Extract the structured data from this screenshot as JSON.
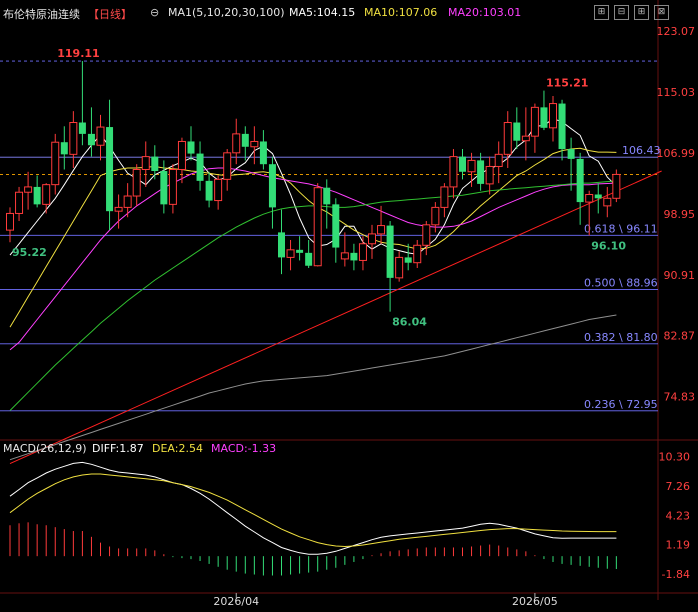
{
  "header": {
    "symbol": "布伦特原油连续",
    "period": "【日线】",
    "ma_label": "MA1(5,10,20,30,100)",
    "ma5": "MA5:104.15",
    "ma10": "MA10:107.06",
    "ma20": "MA20:103.01",
    "colors": {
      "symbol": "#e8e8e8",
      "period": "#ff4a4a",
      "ma5": "#ffffff",
      "ma10": "#f0e040",
      "ma20": "#ff40ff"
    }
  },
  "toolbar": {
    "icons": [
      "settings-icon",
      "grid-icon",
      "grid-icon",
      "close-icon"
    ],
    "glyphs": [
      "⊖",
      "⊞",
      "⊟",
      "⊠"
    ]
  },
  "main_axis": {
    "ylim": [
      69.5,
      124.0
    ],
    "ticks": [
      "123.07",
      "115.03",
      "106.99",
      "98.95",
      "90.91",
      "82.87",
      "74.83"
    ],
    "tick_values": [
      123.07,
      115.03,
      106.99,
      98.95,
      90.91,
      82.87,
      74.83
    ]
  },
  "price_lines": [
    {
      "value": 106.43,
      "label": "106.43",
      "color": "#8888ff",
      "style": "solid"
    },
    {
      "value": 104.15,
      "label": "",
      "color": "#ffaa00",
      "style": "dashed"
    },
    {
      "value": 96.11,
      "label": "0.618 \\ 96.11",
      "color": "#7070ff",
      "style": "solid"
    },
    {
      "value": 88.96,
      "label": "0.500 \\ 88.96",
      "color": "#7070ff",
      "style": "solid"
    },
    {
      "value": 81.8,
      "label": "0.382 \\ 81.80",
      "color": "#7070ff",
      "style": "solid"
    },
    {
      "value": 72.95,
      "label": "0.236 \\ 72.95",
      "color": "#7070ff",
      "style": "solid"
    },
    {
      "value": 119.11,
      "label": "",
      "color": "#7070ff",
      "style": "dashed"
    }
  ],
  "annotations": [
    {
      "text": "119.11",
      "color": "#ff4040",
      "x": 5,
      "y": 119.11
    },
    {
      "text": "115.21",
      "color": "#ff4040",
      "x": 59,
      "y": 115.21
    },
    {
      "text": "95.22",
      "color": "#40c080",
      "x": 0,
      "y": 95.22
    },
    {
      "text": "86.04",
      "color": "#40c080",
      "x": 42,
      "y": 86.04
    },
    {
      "text": "96.10",
      "color": "#40c080",
      "x": 64,
      "y": 96.1
    }
  ],
  "date_labels": [
    {
      "text": "2026/04",
      "x": 25
    },
    {
      "text": "2026/05",
      "x": 58
    }
  ],
  "chart_data": {
    "type": "candlestick",
    "candles": [
      [
        96.8,
        99.8,
        95.2,
        99.0
      ],
      [
        99.0,
        102.5,
        98.0,
        101.8
      ],
      [
        101.8,
        104.5,
        99.5,
        102.5
      ],
      [
        102.5,
        104.0,
        99.8,
        100.2
      ],
      [
        100.2,
        103.0,
        99.0,
        102.8
      ],
      [
        102.8,
        109.5,
        101.5,
        108.4
      ],
      [
        108.4,
        110.5,
        104.8,
        106.8
      ],
      [
        106.8,
        112.5,
        105.0,
        111.0
      ],
      [
        111.0,
        119.11,
        108.0,
        109.5
      ],
      [
        109.5,
        113.0,
        106.5,
        108.0
      ],
      [
        108.0,
        112.0,
        106.0,
        110.4
      ],
      [
        110.4,
        114.0,
        96.8,
        99.3
      ],
      [
        99.3,
        101.5,
        97.0,
        99.8
      ],
      [
        99.8,
        103.0,
        98.5,
        101.3
      ],
      [
        101.3,
        105.5,
        100.0,
        104.8
      ],
      [
        104.8,
        108.5,
        102.5,
        106.5
      ],
      [
        106.5,
        108.0,
        103.5,
        104.6
      ],
      [
        104.6,
        106.0,
        99.0,
        100.2
      ],
      [
        100.2,
        105.5,
        99.0,
        104.8
      ],
      [
        104.8,
        109.0,
        103.0,
        108.5
      ],
      [
        108.5,
        110.5,
        106.0,
        106.9
      ],
      [
        106.9,
        108.5,
        102.0,
        103.3
      ],
      [
        103.3,
        104.5,
        99.8,
        100.7
      ],
      [
        100.7,
        104.0,
        99.5,
        103.5
      ],
      [
        103.5,
        107.5,
        102.0,
        107.0
      ],
      [
        107.0,
        111.5,
        105.5,
        109.5
      ],
      [
        109.5,
        110.5,
        106.0,
        107.8
      ],
      [
        107.8,
        110.5,
        105.5,
        108.5
      ],
      [
        108.5,
        110.0,
        104.8,
        105.5
      ],
      [
        105.5,
        106.5,
        97.0,
        99.8
      ],
      [
        96.5,
        99.5,
        91.0,
        93.2
      ],
      [
        93.2,
        95.5,
        91.5,
        94.2
      ],
      [
        94.2,
        96.0,
        92.8,
        93.8
      ],
      [
        93.8,
        95.5,
        91.8,
        92.1
      ],
      [
        92.1,
        103.0,
        92.0,
        102.4
      ],
      [
        102.4,
        103.5,
        97.0,
        100.2
      ],
      [
        100.2,
        101.0,
        92.5,
        94.5
      ],
      [
        93.0,
        96.5,
        92.0,
        93.8
      ],
      [
        93.8,
        95.0,
        91.5,
        92.8
      ],
      [
        92.8,
        96.0,
        91.5,
        95.0
      ],
      [
        95.0,
        97.5,
        93.0,
        96.3
      ],
      [
        96.3,
        100.0,
        95.0,
        97.4
      ],
      [
        97.4,
        98.0,
        86.04,
        90.5
      ],
      [
        90.5,
        94.0,
        90.0,
        93.2
      ],
      [
        93.2,
        95.0,
        91.5,
        92.5
      ],
      [
        92.5,
        95.5,
        91.8,
        94.8
      ],
      [
        94.8,
        98.0,
        93.5,
        97.5
      ],
      [
        97.5,
        100.5,
        96.5,
        99.8
      ],
      [
        99.8,
        103.0,
        98.5,
        102.5
      ],
      [
        102.5,
        107.5,
        101.0,
        106.5
      ],
      [
        106.5,
        107.5,
        103.5,
        104.5
      ],
      [
        104.5,
        107.0,
        102.5,
        106.0
      ],
      [
        106.0,
        107.0,
        102.0,
        102.9
      ],
      [
        102.9,
        106.5,
        101.5,
        105.2
      ],
      [
        105.2,
        108.5,
        103.0,
        106.8
      ],
      [
        106.8,
        112.5,
        105.0,
        111.0
      ],
      [
        111.0,
        113.0,
        107.5,
        108.6
      ],
      [
        108.6,
        113.0,
        106.0,
        109.2
      ],
      [
        109.2,
        113.5,
        107.0,
        113.0
      ],
      [
        113.0,
        115.21,
        110.0,
        110.3
      ],
      [
        110.3,
        114.5,
        108.5,
        113.5
      ],
      [
        113.5,
        114.0,
        106.0,
        107.5
      ],
      [
        107.5,
        109.0,
        102.0,
        106.2
      ],
      [
        106.2,
        107.0,
        97.5,
        100.5
      ],
      [
        100.5,
        102.0,
        96.1,
        101.5
      ],
      [
        101.5,
        103.0,
        99.0,
        101.0
      ],
      [
        100.0,
        102.5,
        98.5,
        101.0
      ],
      [
        101.0,
        104.8,
        100.5,
        104.15
      ]
    ],
    "ma": {
      "MA5": {
        "color": "#ffffff",
        "values": [
          93.5,
          95,
          96.5,
          98,
          99.5,
          101,
          102.8,
          104.7,
          106.5,
          108,
          109.4,
          107.8,
          106,
          104.3,
          103.6,
          102.8,
          104.1,
          104.7,
          105.3,
          105.8,
          106.3,
          105.8,
          104.3,
          103.4,
          103.8,
          104.9,
          105.7,
          107.3,
          107.9,
          106.9,
          104.3,
          101.5,
          98.4,
          95.8,
          94.7,
          94.9,
          95.6,
          97.3,
          97.3,
          95.2,
          94.3,
          95,
          94.4,
          94.1,
          93.8,
          93.6,
          94.6,
          95.6,
          97.5,
          100.2,
          102.3,
          103.3,
          104.3,
          104.9,
          105.4,
          106.3,
          107.8,
          108.7,
          110.5,
          110.6,
          111.5,
          111.1,
          110.2,
          109.3,
          106.6,
          105.9,
          103.8,
          102.6
        ]
      },
      "MA10": {
        "color": "#f0e040",
        "values": [
          84,
          86,
          88,
          90,
          92,
          94,
          96,
          98,
          100,
          102,
          104,
          104.5,
          104.8,
          105,
          105,
          105.1,
          105.2,
          105,
          104.9,
          104.8,
          104.6,
          104.5,
          104.3,
          104.1,
          104,
          104.1,
          104.2,
          104.4,
          104.5,
          104.3,
          103.8,
          103,
          101.8,
          100.7,
          99.8,
          99.2,
          98.4,
          97.6,
          96.8,
          96.2,
          95.6,
          95.2,
          95,
          94.9,
          94.6,
          94.3,
          94.4,
          94.8,
          95.6,
          96.6,
          97.8,
          98.9,
          100,
          101,
          102,
          103,
          104,
          104.6,
          105.4,
          106.1,
          106.9,
          107.3,
          107.5,
          107.6,
          107.3,
          107.1,
          107.1,
          107.06
        ]
      },
      "MA20": {
        "color": "#ff40ff",
        "values": [
          81,
          82,
          83.5,
          85,
          86.5,
          88,
          89.5,
          91,
          92.5,
          94,
          95.5,
          96.8,
          98,
          99,
          100,
          100.8,
          101.6,
          102.4,
          103,
          103.6,
          104.2,
          104.6,
          104.9,
          105,
          105,
          104.8,
          104.6,
          104.3,
          104,
          103.7,
          103.5,
          103.3,
          103.1,
          102.9,
          102.6,
          102.2,
          101.8,
          101.3,
          100.8,
          100.3,
          99.8,
          99.3,
          98.8,
          98.3,
          97.8,
          97.5,
          97.3,
          97.2,
          97.2,
          97.3,
          97.6,
          98,
          98.6,
          99.2,
          99.8,
          100.3,
          100.8,
          101.3,
          101.8,
          102.2,
          102.5,
          102.7,
          102.8,
          102.8,
          102.8,
          102.9,
          102.95,
          103.01
        ]
      },
      "MA30": {
        "color": "#30c030",
        "values": [
          73,
          74.2,
          75.4,
          76.6,
          77.8,
          79,
          80.1,
          81.2,
          82.3,
          83.4,
          84.5,
          85.5,
          86.5,
          87.5,
          88.4,
          89.3,
          90.2,
          91,
          91.8,
          92.6,
          93.4,
          94.2,
          95,
          95.8,
          96.5,
          97.2,
          97.8,
          98.4,
          98.9,
          99.3,
          99.6,
          99.8,
          99.9,
          100,
          100,
          99.9,
          99.8,
          99.8,
          99.9,
          100.1,
          100.3,
          100.5,
          100.6,
          100.7,
          100.8,
          100.9,
          101,
          101.1,
          101.2,
          101.3,
          101.4,
          101.6,
          101.8,
          102,
          102.1,
          102.2,
          102.3,
          102.4,
          102.5,
          102.6,
          102.7,
          102.8,
          102.9,
          103,
          103,
          103.1,
          103.2,
          103.3
        ]
      },
      "MA100": {
        "color": "#909090",
        "values": [
          66.5,
          66.9,
          67.3,
          67.7,
          68.1,
          68.5,
          68.9,
          69.3,
          69.7,
          70.1,
          70.5,
          70.9,
          71.3,
          71.7,
          72.1,
          72.5,
          72.9,
          73.3,
          73.7,
          74.1,
          74.5,
          74.9,
          75.3,
          75.6,
          75.9,
          76.2,
          76.5,
          76.7,
          76.9,
          77,
          77.1,
          77.2,
          77.3,
          77.4,
          77.5,
          77.6,
          77.8,
          78,
          78.2,
          78.4,
          78.6,
          78.8,
          79,
          79.2,
          79.4,
          79.6,
          79.8,
          80,
          80.2,
          80.5,
          80.8,
          81.1,
          81.4,
          81.7,
          82,
          82.3,
          82.6,
          82.9,
          83.2,
          83.5,
          83.8,
          84.1,
          84.4,
          84.7,
          85,
          85.2,
          85.4,
          85.6
        ]
      }
    },
    "trendline": {
      "color": "#ff2020",
      "from": [
        0,
        66.0
      ],
      "to": [
        72,
        104.6
      ]
    },
    "macd": {
      "params": "MACD(26,12,9)",
      "diff": "DIFF:1.87",
      "dea": "DEA:2.54",
      "macd": "MACD:-1.33",
      "ylim": [
        -3.5,
        11.5
      ],
      "ticks": [
        "10.30",
        "7.26",
        "4.23",
        "1.19",
        "-1.84"
      ],
      "tick_values": [
        10.3,
        7.26,
        4.23,
        1.19,
        -1.84
      ],
      "diff_values": [
        6.2,
        6.9,
        7.6,
        8.1,
        8.6,
        9.0,
        9.3,
        9.6,
        9.7,
        9.5,
        9.2,
        8.9,
        8.7,
        8.6,
        8.5,
        8.4,
        8.2,
        7.9,
        7.6,
        7.4,
        7.0,
        6.5,
        5.9,
        5.2,
        4.5,
        3.8,
        3.1,
        2.5,
        1.9,
        1.4,
        0.9,
        0.6,
        0.35,
        0.2,
        0.2,
        0.3,
        0.5,
        0.8,
        1.1,
        1.4,
        1.7,
        1.95,
        2.1,
        2.2,
        2.3,
        2.4,
        2.5,
        2.6,
        2.7,
        2.8,
        2.9,
        3.1,
        3.3,
        3.4,
        3.3,
        3.1,
        2.9,
        2.6,
        2.3,
        2.1,
        1.9,
        1.85,
        1.87,
        1.87,
        1.87,
        1.87,
        1.87,
        1.87
      ],
      "dea_values": [
        4.5,
        5.2,
        5.9,
        6.5,
        7.0,
        7.5,
        7.9,
        8.2,
        8.4,
        8.5,
        8.5,
        8.4,
        8.3,
        8.2,
        8.1,
        8.0,
        7.9,
        7.8,
        7.6,
        7.4,
        7.2,
        6.9,
        6.6,
        6.2,
        5.8,
        5.3,
        4.8,
        4.3,
        3.8,
        3.3,
        2.8,
        2.4,
        2.0,
        1.7,
        1.4,
        1.2,
        1.05,
        1.0,
        1.05,
        1.15,
        1.3,
        1.45,
        1.6,
        1.75,
        1.85,
        1.95,
        2.05,
        2.15,
        2.25,
        2.35,
        2.45,
        2.55,
        2.65,
        2.75,
        2.8,
        2.85,
        2.85,
        2.8,
        2.75,
        2.7,
        2.65,
        2.6,
        2.58,
        2.56,
        2.55,
        2.54,
        2.54,
        2.54
      ],
      "hist_values": [
        3.2,
        3.4,
        3.5,
        3.3,
        3.2,
        3.0,
        2.8,
        2.6,
        2.6,
        2.0,
        1.4,
        1.0,
        0.8,
        0.8,
        0.8,
        0.8,
        0.6,
        0.2,
        -0.1,
        -0.2,
        -0.3,
        -0.5,
        -0.8,
        -1.1,
        -1.4,
        -1.6,
        -1.8,
        -1.9,
        -2.0,
        -2.0,
        -2.0,
        -1.9,
        -1.8,
        -1.7,
        -1.6,
        -1.4,
        -1.2,
        -0.9,
        -0.6,
        -0.3,
        0.1,
        0.3,
        0.5,
        0.6,
        0.7,
        0.8,
        0.9,
        0.9,
        0.9,
        0.9,
        0.9,
        1.0,
        1.1,
        1.2,
        1.1,
        0.9,
        0.7,
        0.5,
        0.1,
        -0.3,
        -0.6,
        -0.8,
        -0.9,
        -1.0,
        -1.1,
        -1.2,
        -1.3,
        -1.33
      ]
    }
  }
}
